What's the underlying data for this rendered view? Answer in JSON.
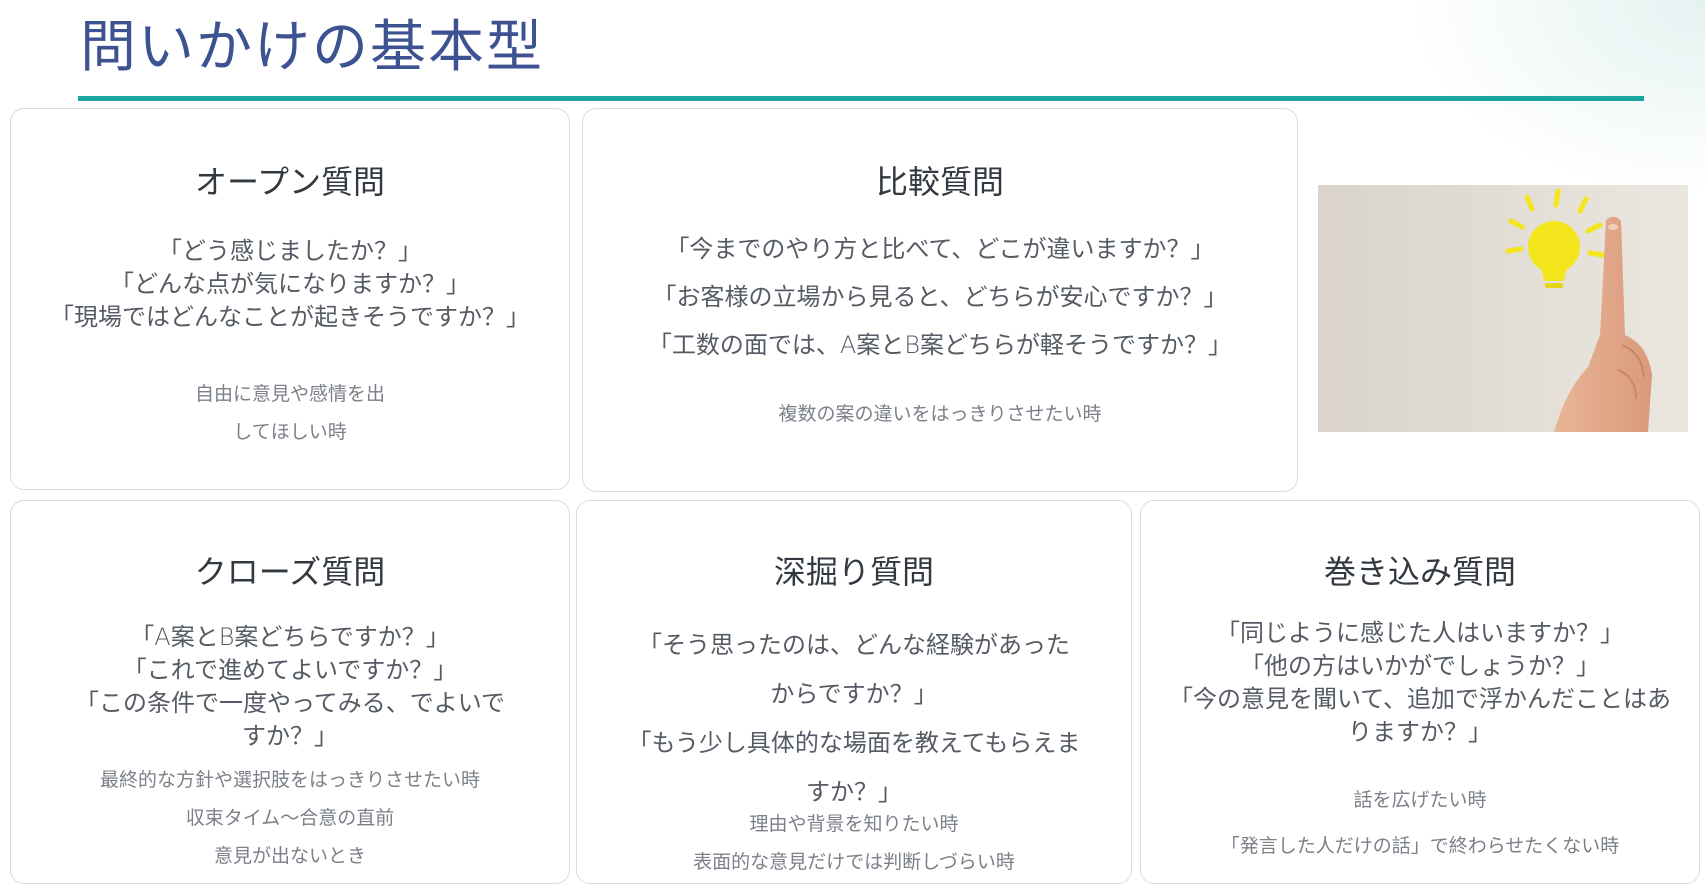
{
  "slide": {
    "title": "問いかけの基本型"
  },
  "colors": {
    "title": "#3d5290",
    "rule": "#1aa59d",
    "card_border": "#d6dbe4",
    "bulb": "#f4e61c"
  },
  "cards": {
    "open": {
      "title": "オープン質問",
      "questions": [
        "「どう感じましたか？」",
        "「どんな点が気になりますか？」",
        "「現場ではどんなことが起きそうですか？」"
      ],
      "notes": [
        "自由に意見や感情を出",
        "してほしい時"
      ]
    },
    "compare": {
      "title": "比較質問",
      "questions": [
        "「今までのやり方と比べて、どこが違いますか？」",
        "「お客様の立場から見ると、どちらが安心ですか？」",
        "「工数の面では、A案とB案どちらが軽そうですか？」"
      ],
      "notes": [
        "複数の案の違いをはっきりさせたい時"
      ]
    },
    "closed": {
      "title": "クローズ質問",
      "questions": [
        "「A案とB案どちらですか？」",
        "「これで進めてよいですか？」",
        "「この条件で一度やってみる、でよいですか？」"
      ],
      "notes": [
        "最終的な方針や選択肢をはっきりさせたい時",
        "収束タイム〜合意の直前",
        "意見が出ないとき"
      ]
    },
    "deep": {
      "title": "深掘り質問",
      "questions": [
        "「そう思ったのは、どんな経験があったからですか？」",
        "「もう少し具体的な場面を教えてもらえますか？」"
      ],
      "notes": [
        "理由や背景を知りたい時",
        "表面的な意見だけでは判断しづらい時"
      ]
    },
    "involve": {
      "title": "巻き込み質問",
      "questions": [
        "「同じように感じた人はいますか？」",
        "「他の方はいかがでしょうか？」",
        "「今の意見を聞いて、追加で浮かんだことはありますか？」"
      ],
      "notes": [
        "話を広げたい時",
        "「発言した人だけの話」で終わらせたくない時"
      ]
    }
  },
  "image": {
    "icon": "lightbulb-icon"
  }
}
